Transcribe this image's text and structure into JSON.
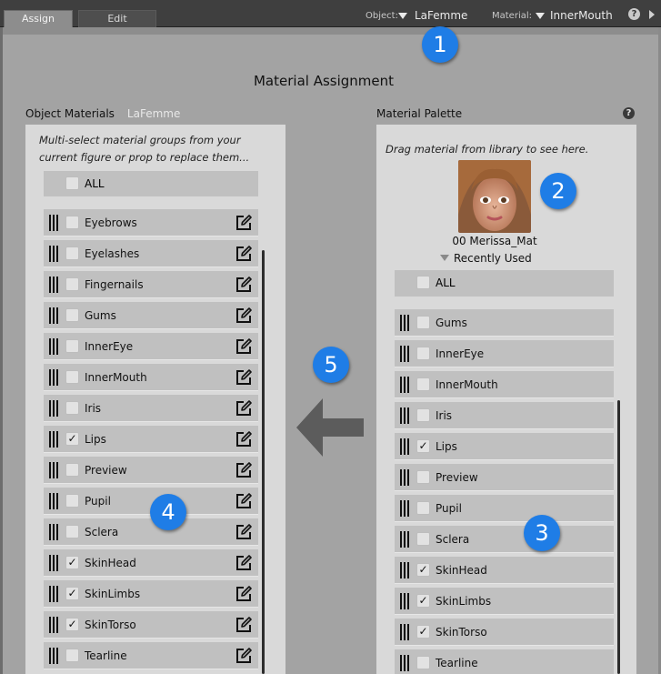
{
  "tabs": [
    {
      "label": "Assign",
      "active": true
    },
    {
      "label": "Edit",
      "active": false
    }
  ],
  "toolbar": {
    "object_label": "Object:",
    "object_value": "LaFemme",
    "material_label": "Material:",
    "material_value": "InnerMouth",
    "help_label": "?"
  },
  "title": "Material Assignment",
  "object_materials": {
    "header": "Object Materials",
    "figure": "LaFemme",
    "hint_line1": "Multi-select material groups from your",
    "hint_line2": "current figure or prop to replace them...",
    "all_label": "ALL",
    "items": [
      {
        "label": "Eyebrows",
        "checked": false
      },
      {
        "label": "Eyelashes",
        "checked": false
      },
      {
        "label": "Fingernails",
        "checked": false
      },
      {
        "label": "Gums",
        "checked": false
      },
      {
        "label": "InnerEye",
        "checked": false
      },
      {
        "label": "InnerMouth",
        "checked": false
      },
      {
        "label": "Iris",
        "checked": false
      },
      {
        "label": "Lips",
        "checked": true
      },
      {
        "label": "Preview",
        "checked": false
      },
      {
        "label": "Pupil",
        "checked": false
      },
      {
        "label": "Sclera",
        "checked": false
      },
      {
        "label": "SkinHead",
        "checked": true
      },
      {
        "label": "SkinLimbs",
        "checked": true
      },
      {
        "label": "SkinTorso",
        "checked": true
      },
      {
        "label": "Tearline",
        "checked": false
      }
    ]
  },
  "material_palette": {
    "header": "Material Palette",
    "help_label": "?",
    "hint": "Drag material from library to see here.",
    "thumb_name": "00 Merissa_Mat",
    "recently_used": "Recently Used",
    "all_label": "ALL",
    "items": [
      {
        "label": "Gums",
        "checked": false
      },
      {
        "label": "InnerEye",
        "checked": false
      },
      {
        "label": "InnerMouth",
        "checked": false
      },
      {
        "label": "Iris",
        "checked": false
      },
      {
        "label": "Lips",
        "checked": true
      },
      {
        "label": "Preview",
        "checked": false
      },
      {
        "label": "Pupil",
        "checked": false
      },
      {
        "label": "Sclera",
        "checked": false
      },
      {
        "label": "SkinHead",
        "checked": true
      },
      {
        "label": "SkinLimbs",
        "checked": true
      },
      {
        "label": "SkinTorso",
        "checked": true
      },
      {
        "label": "Tearline",
        "checked": false
      }
    ]
  },
  "callouts": [
    "1",
    "2",
    "3",
    "4",
    "5"
  ],
  "colors": {
    "callout": "#1f7de6",
    "accent": "#e8e8e8"
  }
}
